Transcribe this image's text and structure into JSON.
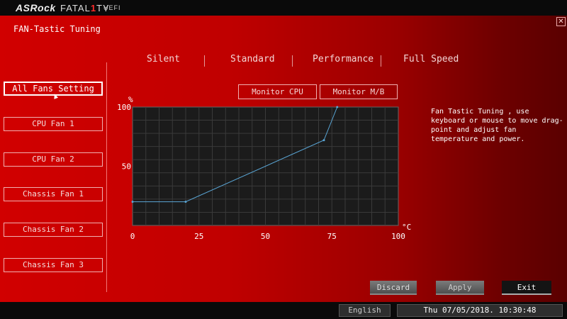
{
  "header": {
    "brand": "ASRock",
    "sub_brand_pre": "FATAL",
    "sub_brand_one": "1",
    "sub_brand_post": "TY",
    "uefi": "UEFI"
  },
  "page": {
    "title": "FAN-Tastic Tuning",
    "close_icon": "close-icon"
  },
  "fans": [
    {
      "label": "All Fans Setting",
      "active": true
    },
    {
      "label": "CPU Fan 1",
      "active": false
    },
    {
      "label": "CPU Fan 2",
      "active": false
    },
    {
      "label": "Chassis Fan 1",
      "active": false
    },
    {
      "label": "Chassis Fan 2",
      "active": false
    },
    {
      "label": "Chassis Fan 3",
      "active": false
    }
  ],
  "modes": [
    "Silent",
    "Standard",
    "Performance",
    "Full Speed"
  ],
  "monitors": [
    "Monitor CPU",
    "Monitor M/B"
  ],
  "help": "Fan Tastic Tuning , use keyboard or mouse to move drag-point and adjust fan temperature and power.",
  "chart_data": {
    "type": "line",
    "xlabel": "°C",
    "ylabel": "%",
    "xlim": [
      0,
      100
    ],
    "ylim": [
      0,
      100
    ],
    "x_ticks": [
      "0",
      "25",
      "50",
      "75",
      "100"
    ],
    "y_ticks": [
      "50",
      "100"
    ],
    "grid": true,
    "series": [
      {
        "x": [
          0,
          20,
          72,
          77
        ],
        "y": [
          20,
          20,
          72,
          100
        ]
      }
    ],
    "colors": {
      "line": "#5aa6d6",
      "grid": "#3a3a3a",
      "background": "#1b1b1b"
    }
  },
  "buttons": {
    "discard": "Discard",
    "apply": "Apply",
    "exit": "Exit"
  },
  "status": {
    "language": "English",
    "datetime": "Thu 07/05/2018. 10:30:48"
  }
}
